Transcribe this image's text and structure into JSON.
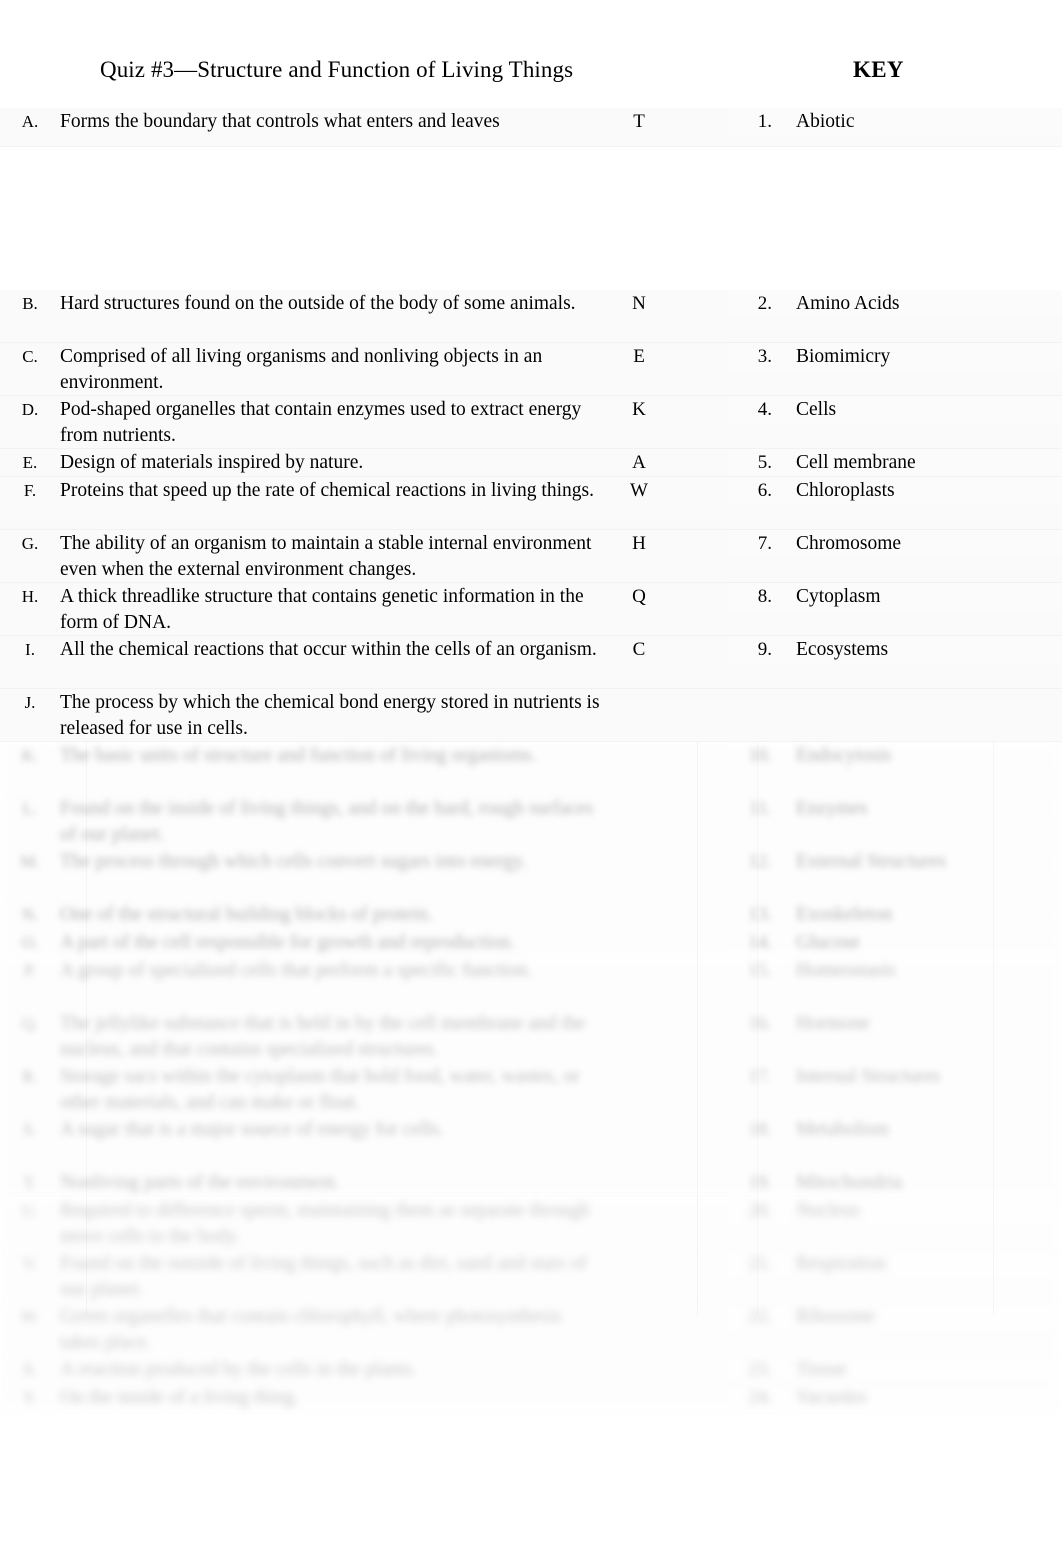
{
  "header": {
    "title": "Quiz #3—Structure and Function of Living Things",
    "key_label": "KEY"
  },
  "definitions": [
    {
      "letter": "A.",
      "text": "Forms the boundary that controls what enters and leaves",
      "answer": "T",
      "legible": true
    },
    {
      "letter": "B.",
      "text": "Hard structures found on the outside of the body of some animals.",
      "answer": "N",
      "legible": true
    },
    {
      "letter": "C.",
      "text": "Comprised of all living organisms and nonliving objects in an environment.",
      "answer": "E",
      "legible": true
    },
    {
      "letter": "D.",
      "text": "Pod-shaped organelles that contain enzymes used to extract energy from nutrients.",
      "answer": "K",
      "legible": true
    },
    {
      "letter": "E.",
      "text": "Design of materials inspired by nature.",
      "answer": "A",
      "legible": true
    },
    {
      "letter": "F.",
      "text": "Proteins that speed up the rate of chemical reactions in living things.",
      "answer": "W",
      "legible": true
    },
    {
      "letter": "G.",
      "text": "The ability of an organism to maintain a stable internal environment even when the external environment changes.",
      "answer": "H",
      "legible": true
    },
    {
      "letter": "H.",
      "text": "A thick threadlike structure that contains genetic information in the form of DNA.",
      "answer": "Q",
      "legible": true
    },
    {
      "letter": "I.",
      "text": "All the chemical reactions that occur within the cells of an organism.",
      "answer": "C",
      "legible": true
    },
    {
      "letter": "J.",
      "text": "The process by which the chemical bond energy stored in nutrients is released for use in cells.",
      "answer": "",
      "legible": true
    }
  ],
  "definitions_illegible": [
    {
      "letter": "K.",
      "text": "The basic units of structure and function of living organisms.",
      "answer": ""
    },
    {
      "letter": "L.",
      "text": "Found on the inside of living things, and on the hard, rough surfaces of our planet.",
      "answer": ""
    },
    {
      "letter": "M.",
      "text": "The process through which cells convert sugars into energy.",
      "answer": ""
    },
    {
      "letter": "N.",
      "text": "One of the structural building blocks of protein.",
      "answer": ""
    },
    {
      "letter": "O.",
      "text": "A part of the cell responsible for growth and reproduction.",
      "answer": ""
    },
    {
      "letter": "P.",
      "text": "A group of specialized cells that perform a specific function.",
      "answer": ""
    },
    {
      "letter": "Q.",
      "text": "The jellylike substance that is held in by the cell membrane and the nucleus, and that contains specialized structures.",
      "answer": ""
    },
    {
      "letter": "R.",
      "text": "Storage sacs within the cytoplasm that hold food, water, wastes, or other materials, and can make or float.",
      "answer": ""
    },
    {
      "letter": "S.",
      "text": "A sugar that is a major source of energy for cells.",
      "answer": ""
    },
    {
      "letter": "T.",
      "text": "Nonliving parts of the environment.",
      "answer": ""
    },
    {
      "letter": "U.",
      "text": "Required to difference sperm, maintaining them as separate through move cells to the body.",
      "answer": ""
    },
    {
      "letter": "V.",
      "text": "Found on the outside of living things, such as dirt, sand and stars of our planet.",
      "answer": ""
    },
    {
      "letter": "W.",
      "text": "Green organelles that contain chlorophyll, where photosynthesis takes place.",
      "answer": ""
    },
    {
      "letter": "X.",
      "text": "A reaction produced by the cells in the plants.",
      "answer": ""
    },
    {
      "letter": "Y.",
      "text": "On the inside of a living thing.",
      "answer": ""
    }
  ],
  "terms": [
    {
      "number": "1.",
      "text": "Abiotic",
      "legible": true
    },
    {
      "number": "2.",
      "text": "Amino Acids",
      "legible": true
    },
    {
      "number": "3.",
      "text": "Biomimicry",
      "legible": true
    },
    {
      "number": "4.",
      "text": "Cells",
      "legible": true
    },
    {
      "number": "5.",
      "text": "Cell membrane",
      "legible": true
    },
    {
      "number": "6.",
      "text": "Chloroplasts",
      "legible": true
    },
    {
      "number": "7.",
      "text": "Chromosome",
      "legible": true
    },
    {
      "number": "8.",
      "text": "Cytoplasm",
      "legible": true
    },
    {
      "number": "9.",
      "text": "Ecosystems",
      "legible": true
    }
  ],
  "terms_illegible": [
    {
      "number": "10.",
      "text": "Endocytosis"
    },
    {
      "number": "11.",
      "text": "Enzymes"
    },
    {
      "number": "12.",
      "text": "External Structures"
    },
    {
      "number": "13.",
      "text": "Exoskeleton"
    },
    {
      "number": "14.",
      "text": "Glucose"
    },
    {
      "number": "15.",
      "text": "Homeostasis"
    },
    {
      "number": "16.",
      "text": "Hormone"
    },
    {
      "number": "17.",
      "text": "Internal Structures"
    },
    {
      "number": "18.",
      "text": "Metabolism"
    },
    {
      "number": "19.",
      "text": "Mitochondria"
    },
    {
      "number": "20.",
      "text": "Nucleus"
    },
    {
      "number": "21.",
      "text": "Respiration"
    },
    {
      "number": "22.",
      "text": "Ribosome"
    },
    {
      "number": "23.",
      "text": "Tissue"
    },
    {
      "number": "24.",
      "text": "Vacuoles"
    }
  ]
}
